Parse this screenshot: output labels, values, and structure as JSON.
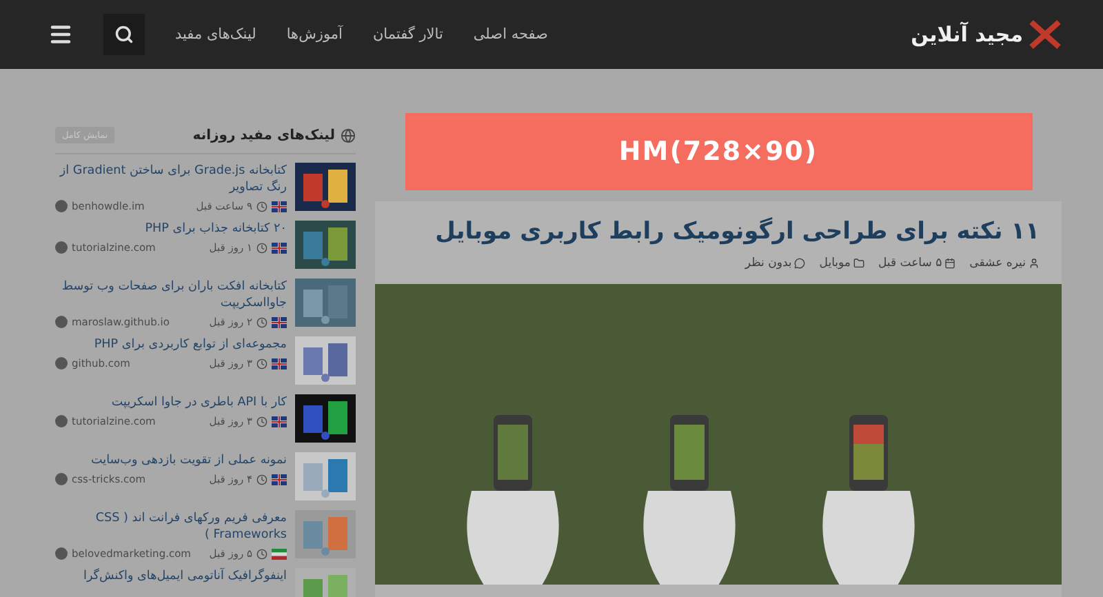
{
  "header": {
    "logo": "مجید آنلاین",
    "nav": [
      {
        "label": "صفحه اصلی"
      },
      {
        "label": "تالار گفتمان"
      },
      {
        "label": "آموزش‌ها"
      },
      {
        "label": "لینک‌های مفید"
      }
    ]
  },
  "ad": {
    "text": "HM(728×90)"
  },
  "article": {
    "title": "۱۱ نکته برای طراحی ارگونومیک رابط کاربری موبایل",
    "author": "نیره عشقی",
    "time": "۵ ساعت قبل",
    "category": "موبایل",
    "comments": "بدون نظر"
  },
  "sidebar": {
    "title": "لینک‌های مفید روزانه",
    "badge": "نمایش کامل",
    "items": [
      {
        "title": "کتابخانه Grade.js برای ساختن Gradient از رنگ تصاویر",
        "source": "benhowdle.im",
        "time": "۹ ساعت قبل",
        "kind": "uk"
      },
      {
        "title": "۲۰ کتابخانه جذاب برای PHP",
        "source": "tutorialzine.com",
        "time": "۱ روز قبل",
        "kind": "uk"
      },
      {
        "title": "کتابخانه افکت باران برای صفحات وب توسط جاوااسکریپت",
        "source": "maroslaw.github.io",
        "time": "۲ روز قبل",
        "kind": "uk"
      },
      {
        "title": "مجموعه‌ای از توابع کاربردی برای PHP",
        "source": "github.com",
        "time": "۳ روز قبل",
        "kind": "uk"
      },
      {
        "title": "کار با API باطری در جاوا اسکریپت",
        "source": "tutorialzine.com",
        "time": "۳ روز قبل",
        "kind": "uk"
      },
      {
        "title": "نمونه عملی از تقویت بازدهی وب‌سایت",
        "source": "css-tricks.com",
        "time": "۴ روز قبل",
        "kind": "uk"
      },
      {
        "title": "معرفی فریم ورکهای فرانت اند ( CSS Frameworks )",
        "source": "belovedmarketing.com",
        "time": "۵ روز قبل",
        "kind": "iran"
      },
      {
        "title": "اینفوگرافیک آناتومی ایمیل‌های واکنش‌گرا"
      }
    ]
  }
}
